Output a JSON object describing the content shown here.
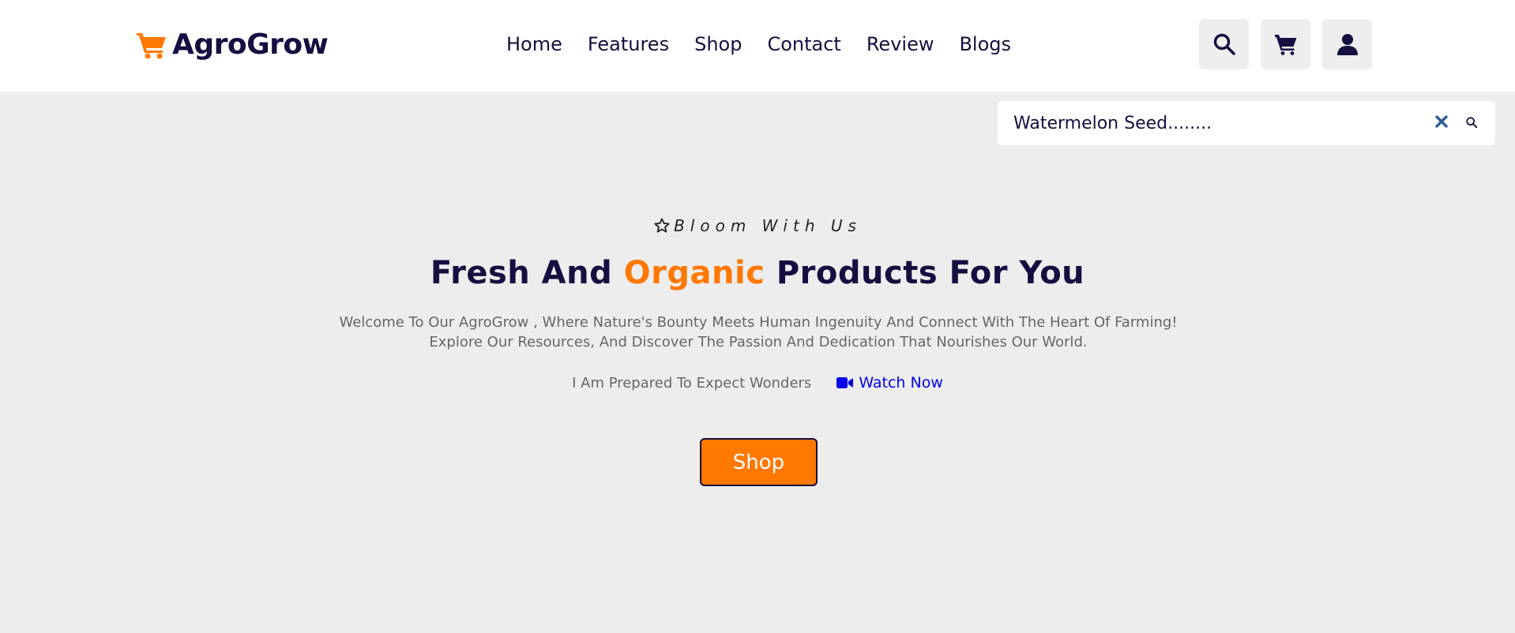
{
  "brand": {
    "name": "AgroGrow",
    "accent": "#ff7800",
    "primary": "#130f40"
  },
  "nav": [
    "Home",
    "Features",
    "Shop",
    "Contact",
    "Review",
    "Blogs"
  ],
  "header_icons": [
    "search-icon",
    "cart-icon",
    "user-icon"
  ],
  "search": {
    "value": "Watermelon Seed........"
  },
  "hero": {
    "tagline": "Bloom With Us",
    "headline_pre": "Fresh And ",
    "headline_accent": "Organic",
    "headline_post": " Products For You",
    "description": "Welcome To Our AgroGrow , Where Nature's Bounty Meets Human Ingenuity And Connect With The Heart Of Farming! Explore Our Resources, And Discover The Passion And Dedication That Nourishes Our World.",
    "cta_text": "I Am Prepared To Expect Wonders",
    "watch_label": "Watch Now",
    "shop_label": "Shop"
  }
}
